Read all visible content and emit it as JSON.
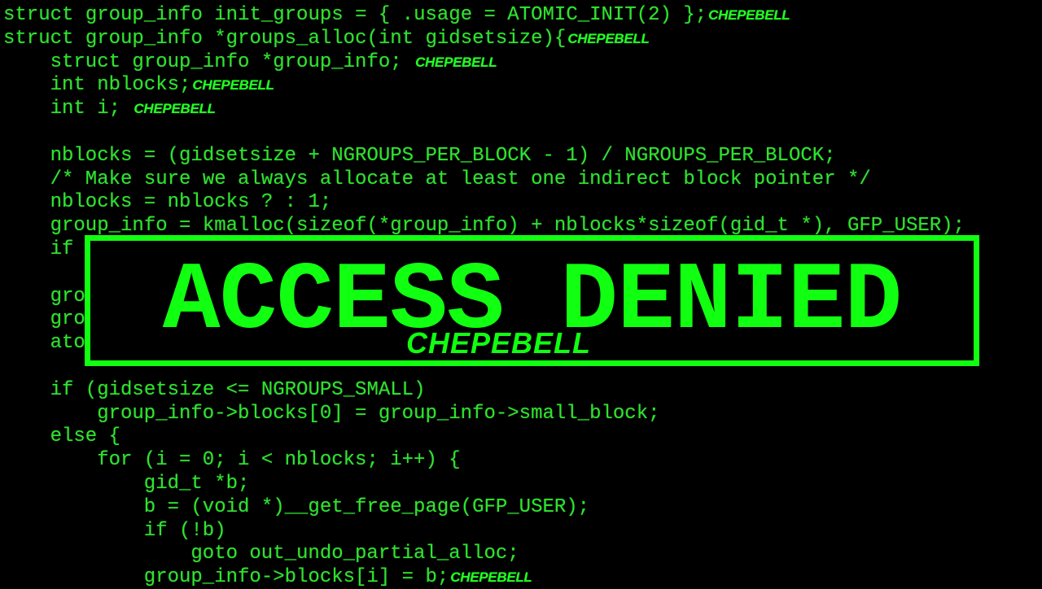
{
  "theme": {
    "background": "#000000",
    "code_color": "#2fe22f",
    "accent_color": "#11ff11"
  },
  "code_lines": [
    {
      "indent": 0,
      "text": "struct group_info init_groups = { .usage = ATOMIC_INIT(2) };",
      "tag": "CHEPEBELL"
    },
    {
      "indent": 0,
      "text": "struct group_info *groups_alloc(int gidsetsize){",
      "tag": "CHEPEBELL"
    },
    {
      "indent": 1,
      "text": "struct group_info *group_info; ",
      "tag": "CHEPEBELL"
    },
    {
      "indent": 1,
      "text": "int nblocks;",
      "tag": "CHEPEBELL"
    },
    {
      "indent": 1,
      "text": "int i; ",
      "tag": "CHEPEBELL"
    },
    {
      "indent": 0,
      "text": "",
      "tag": ""
    },
    {
      "indent": 1,
      "text": "nblocks = (gidsetsize + NGROUPS_PER_BLOCK - 1) / NGROUPS_PER_BLOCK;",
      "tag": ""
    },
    {
      "indent": 1,
      "text": "/* Make sure we always allocate at least one indirect block pointer */",
      "tag": ""
    },
    {
      "indent": 1,
      "text": "nblocks = nblocks ? : 1;",
      "tag": ""
    },
    {
      "indent": 1,
      "text": "group_info = kmalloc(sizeof(*group_info) + nblocks*sizeof(gid_t *), GFP_USER);",
      "tag": ""
    },
    {
      "indent": 1,
      "text": "if",
      "tag": ""
    },
    {
      "indent": 0,
      "text": "",
      "tag": ""
    },
    {
      "indent": 1,
      "text": "gro",
      "tag": ""
    },
    {
      "indent": 1,
      "text": "gro",
      "tag": ""
    },
    {
      "indent": 1,
      "text": "ato",
      "tag": ""
    },
    {
      "indent": 0,
      "text": "",
      "tag": ""
    },
    {
      "indent": 1,
      "text": "if (gidsetsize <= NGROUPS_SMALL)",
      "tag": ""
    },
    {
      "indent": 2,
      "text": "group_info->blocks[0] = group_info->small_block;",
      "tag": ""
    },
    {
      "indent": 1,
      "text": "else {",
      "tag": ""
    },
    {
      "indent": 2,
      "text": "for (i = 0; i < nblocks; i++) {",
      "tag": ""
    },
    {
      "indent": 3,
      "text": "gid_t *b;",
      "tag": ""
    },
    {
      "indent": 3,
      "text": "b = (void *)__get_free_page(GFP_USER);",
      "tag": ""
    },
    {
      "indent": 3,
      "text": "if (!b)",
      "tag": ""
    },
    {
      "indent": 4,
      "text": "goto out_undo_partial_alloc;",
      "tag": ""
    },
    {
      "indent": 3,
      "text": "group_info->blocks[i] = b;",
      "tag": "CHEPEBELL"
    }
  ],
  "banner": {
    "title": "ACCESS DENIED",
    "subtitle": "CHEPEBELL"
  }
}
